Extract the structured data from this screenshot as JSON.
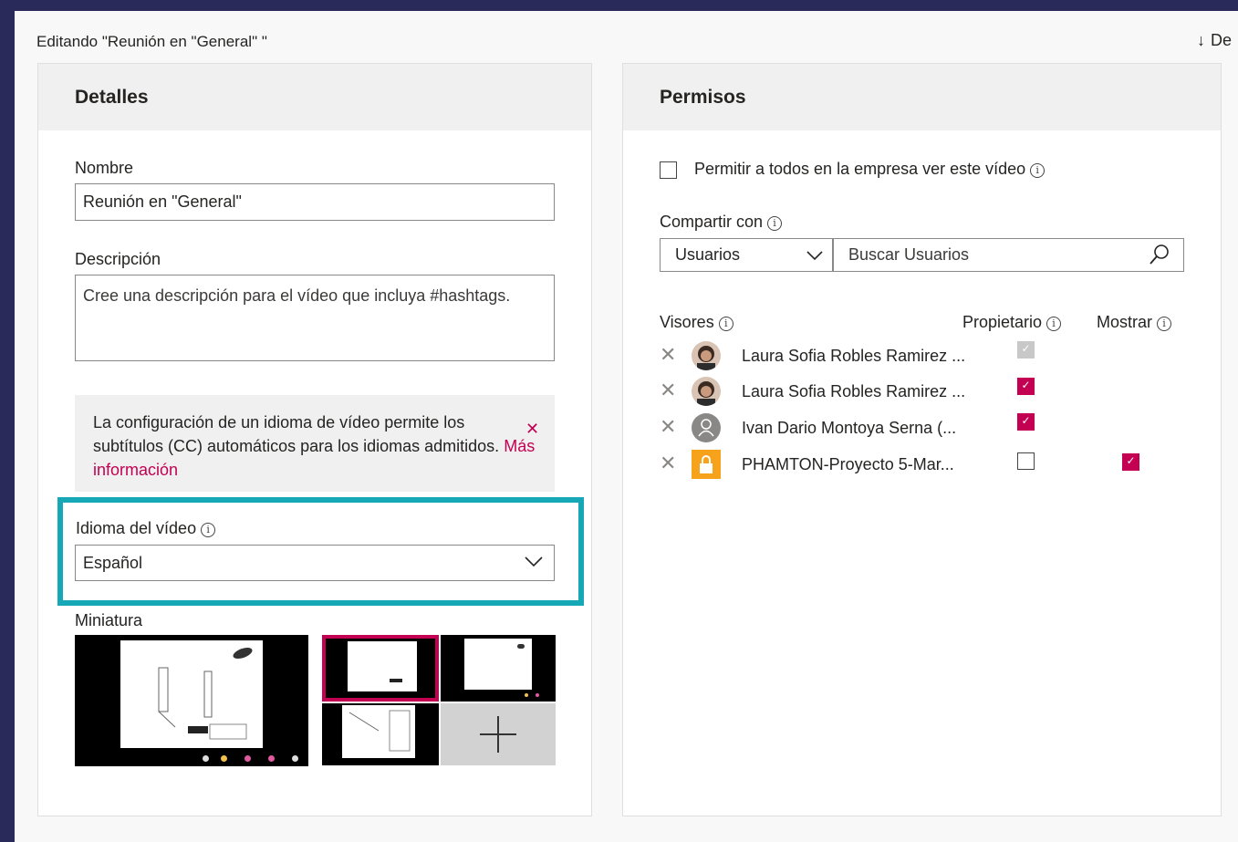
{
  "page": {
    "title": "Editando \"Reunión en \"General\" \"",
    "download_label": "De"
  },
  "details": {
    "header": "Detalles",
    "name_label": "Nombre",
    "name_value": "Reunión en \"General\"",
    "description_label": "Descripción",
    "description_placeholder": "Cree una descripción para el vídeo que incluya #hashtags.",
    "notice_text": "La configuración de un idioma de vídeo permite los subtítulos (CC) automáticos para los idiomas admitidos.",
    "notice_link": "Más información",
    "language_label": "Idioma del vídeo",
    "language_value": "Español",
    "thumbnail_label": "Miniatura"
  },
  "permissions": {
    "header": "Permisos",
    "allow_all_label": "Permitir a todos en la empresa ver este vídeo",
    "share_label": "Compartir con",
    "share_type": "Usuarios",
    "search_placeholder": "Buscar Usuarios",
    "col_viewers": "Visores",
    "col_owner": "Propietario",
    "col_show": "Mostrar",
    "viewers": [
      {
        "name": "Laura Sofia Robles Ramirez ...",
        "owner": "disabled-checked",
        "show": "none",
        "avatar": "photo"
      },
      {
        "name": "Laura Sofia Robles Ramirez ...",
        "owner": "checked",
        "show": "none",
        "avatar": "photo"
      },
      {
        "name": "Ivan Dario Montoya Serna (...",
        "owner": "checked",
        "show": "none",
        "avatar": "person-icon"
      },
      {
        "name": "PHAMTON-Proyecto 5-Mar...",
        "owner": "unchecked",
        "show": "checked",
        "avatar": "lock-icon"
      }
    ]
  },
  "colors": {
    "accent": "#c30052",
    "highlight": "#17a8b8",
    "lock_bg": "#f7a21b"
  }
}
